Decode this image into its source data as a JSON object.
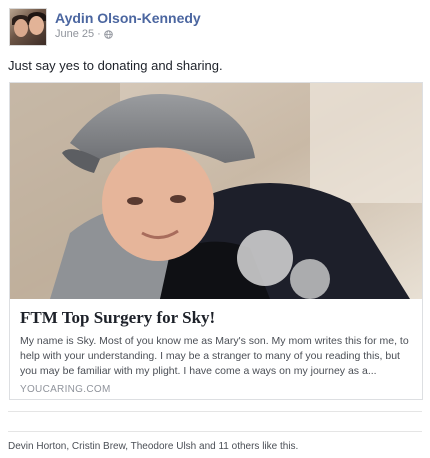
{
  "post": {
    "author": "Aydin Olson-Kennedy",
    "date": "June 25",
    "separator": "·",
    "status_text": "Just say yes to donating and sharing.",
    "audience_icon": "globe-icon"
  },
  "link_card": {
    "title": "FTM Top Surgery for Sky!",
    "description": "My name is Sky. Most of you know me as Mary's son. My mom writes this for me, to help with your understanding. I may be a stranger to many of you reading this, but you may be familiar with my plight. I have come a ways on my journey as a...",
    "domain": "YOUCARING.COM"
  },
  "likes": {
    "text": "Devin Horton, Cristin Brew, Theodore Ulsh and 11 others like this."
  },
  "colors": {
    "author_link": "#4b66a0",
    "meta_gray": "#90949c",
    "border": "#dddfe2"
  }
}
